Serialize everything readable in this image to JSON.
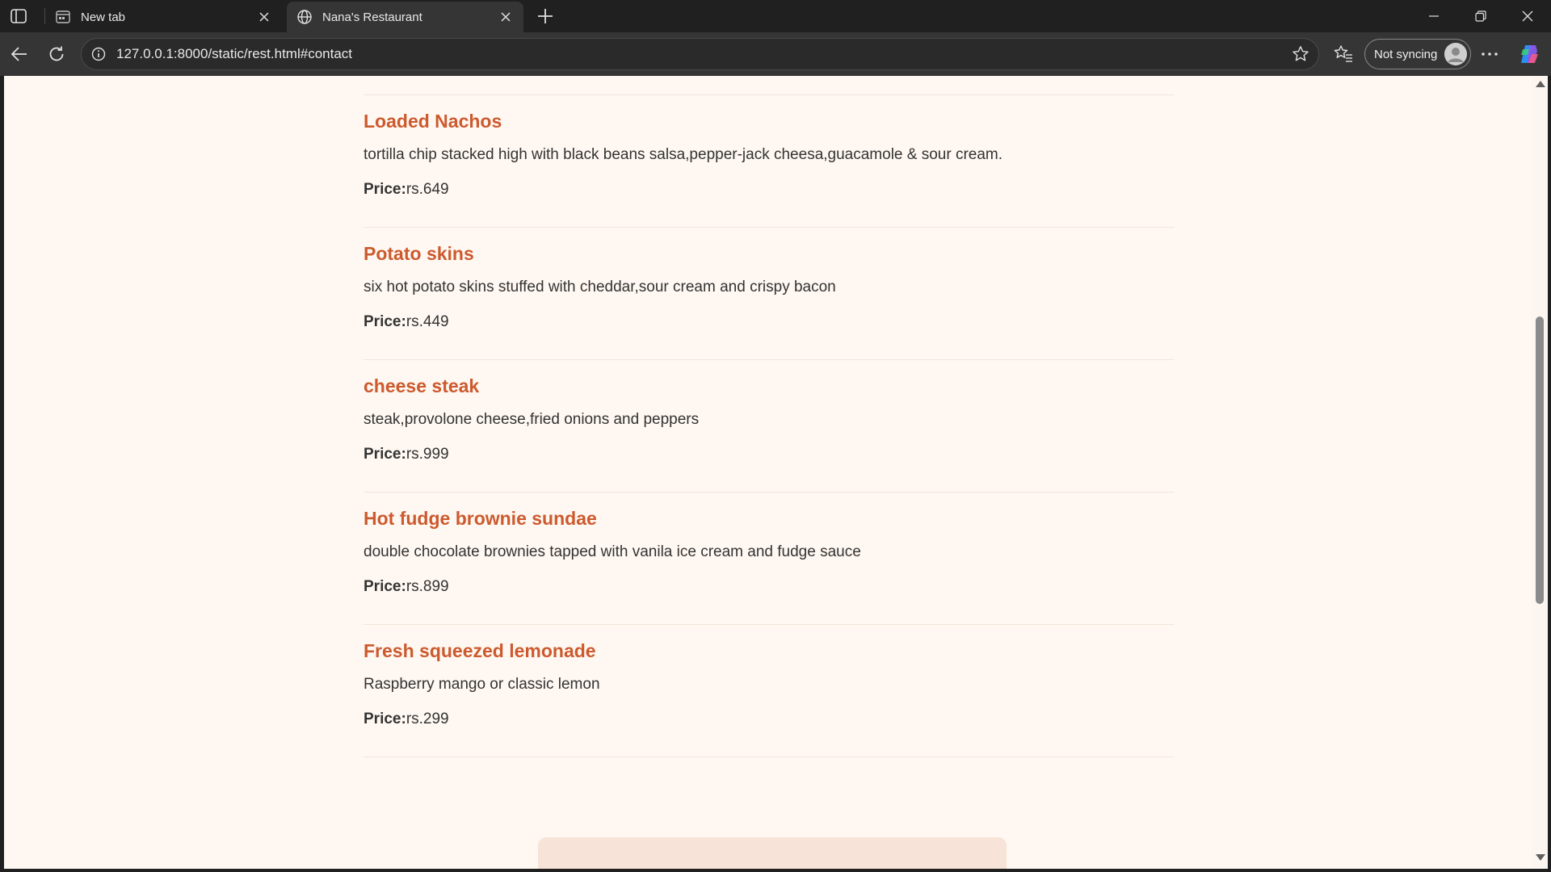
{
  "browser": {
    "tabs": [
      {
        "title": "New tab",
        "active": false
      },
      {
        "title": "Nana's Restaurant",
        "active": true
      }
    ],
    "url": "127.0.0.1:8000/static/rest.html#contact",
    "sync_label": "Not syncing"
  },
  "colors": {
    "accent": "#cc5a2e",
    "page_background": "#fff8f2",
    "card_background": "#f7e3d7"
  },
  "menu": {
    "items": [
      {
        "name": "Loaded Nachos",
        "description": "tortilla chip stacked high with black beans salsa,pepper-jack cheesa,guacamole & sour cream.",
        "price_label": "Price:",
        "price": "rs.649"
      },
      {
        "name": "Potato skins",
        "description": "six hot potato skins stuffed with cheddar,sour cream and crispy bacon",
        "price_label": "Price:",
        "price": "rs.449"
      },
      {
        "name": "cheese steak",
        "description": "steak,provolone cheese,fried onions and peppers",
        "price_label": "Price:",
        "price": "rs.999"
      },
      {
        "name": "Hot fudge brownie sundae",
        "description": "double chocolate brownies tapped with vanila ice cream and fudge sauce",
        "price_label": "Price:",
        "price": "rs.899"
      },
      {
        "name": "Fresh squeezed lemonade",
        "description": "Raspberry mango or classic lemon",
        "price_label": "Price:",
        "price": "rs.299"
      }
    ]
  }
}
